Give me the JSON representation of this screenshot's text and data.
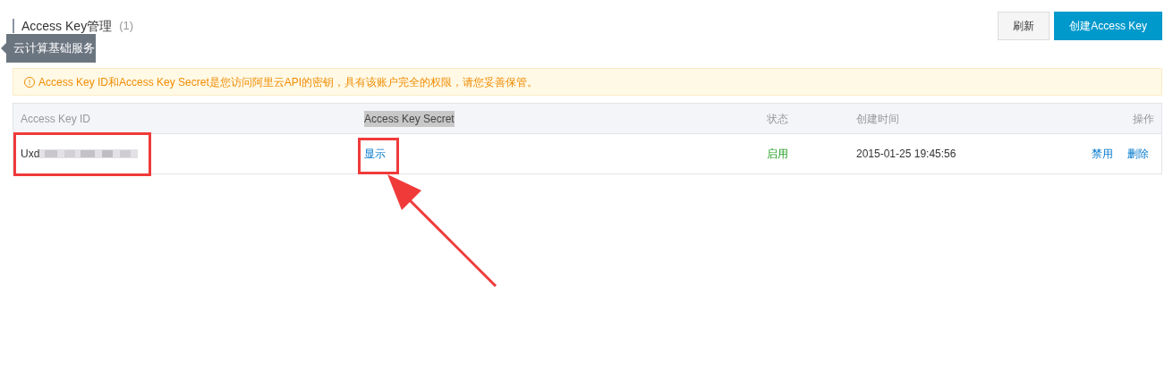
{
  "header": {
    "title": "Access Key管理",
    "count": "(1)",
    "tooltip": "云计算基础服务"
  },
  "buttons": [
    {
      "label": "刷新",
      "kind": "secondary"
    },
    {
      "label": "创建Access Key",
      "kind": "primary"
    }
  ],
  "alert": {
    "icon": "!",
    "text": "Access Key ID和Access Key Secret是您访问阿里云API的密钥，具有该账户完全的权限，请您妥善保管。"
  },
  "table": {
    "columns": [
      {
        "label": "Access Key ID",
        "selected": false
      },
      {
        "label": "Access Key Secret",
        "selected": true
      },
      {
        "label": "状态",
        "selected": false
      },
      {
        "label": "创建时间",
        "selected": false
      },
      {
        "label": "操作",
        "selected": false
      }
    ],
    "rows": [
      {
        "id": "Uxd",
        "secret": "显示",
        "status": "启用",
        "enabled": true,
        "id_highlighted": true,
        "secret_highlighted": true,
        "secret_arrow": true,
        "created": "2015-01-25 19:45:56",
        "actions": [
          "禁用",
          "删除"
        ]
      }
    ]
  }
}
